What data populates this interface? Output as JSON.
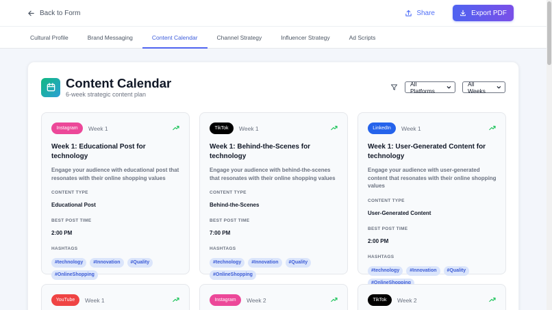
{
  "header": {
    "back_label": "Back to Form",
    "share_label": "Share",
    "export_label": "Export PDF"
  },
  "tabs": [
    {
      "label": "Cultural Profile"
    },
    {
      "label": "Brand Messaging"
    },
    {
      "label": "Content Calendar",
      "active": true
    },
    {
      "label": "Channel Strategy"
    },
    {
      "label": "Influencer Strategy"
    },
    {
      "label": "Ad Scripts"
    }
  ],
  "calendar": {
    "title": "Content Calendar",
    "subtitle": "6-week strategic content plan",
    "platform_filter": "All Platforms",
    "week_filter": "All Weeks"
  },
  "colors": {
    "accent": "#4f63f0",
    "instagram": "#ec4899",
    "tiktok": "#000000",
    "linkedin": "#2563eb",
    "youtube": "#ef4444",
    "trend": "#22c55e"
  },
  "labels": {
    "content_type": "CONTENT TYPE",
    "best_post_time": "BEST POST TIME",
    "hashtags": "HASHTAGS"
  },
  "cards": [
    {
      "platform": "Instagram",
      "platform_color": "#ec4899",
      "week": "Week 1",
      "title": "Week 1: Educational Post for technology",
      "description": "Engage your audience with educational post that resonates with their online shopping values",
      "content_type": "Educational Post",
      "post_time": "2:00 PM",
      "hashtags": [
        "#technology",
        "#Innovation",
        "#Quality",
        "#OnlineShopping"
      ]
    },
    {
      "platform": "TikTok",
      "platform_color": "#000000",
      "week": "Week 1",
      "title": "Week 1: Behind-the-Scenes for technology",
      "description": "Engage your audience with behind-the-scenes that resonates with their online shopping values",
      "content_type": "Behind-the-Scenes",
      "post_time": "7:00 PM",
      "hashtags": [
        "#technology",
        "#Innovation",
        "#Quality",
        "#OnlineShopping"
      ]
    },
    {
      "platform": "LinkedIn",
      "platform_color": "#2563eb",
      "week": "Week 1",
      "title": "Week 1: User-Generated Content for technology",
      "description": "Engage your audience with user-generated content that resonates with their online shopping values",
      "content_type": "User-Generated Content",
      "post_time": "2:00 PM",
      "hashtags": [
        "#technology",
        "#Innovation",
        "#Quality",
        "#OnlineShopping"
      ]
    },
    {
      "platform": "YouTube",
      "platform_color": "#ef4444",
      "week": "Week 1"
    },
    {
      "platform": "Instagram",
      "platform_color": "#ec4899",
      "week": "Week 2"
    },
    {
      "platform": "TikTok",
      "platform_color": "#000000",
      "week": "Week 2"
    }
  ]
}
